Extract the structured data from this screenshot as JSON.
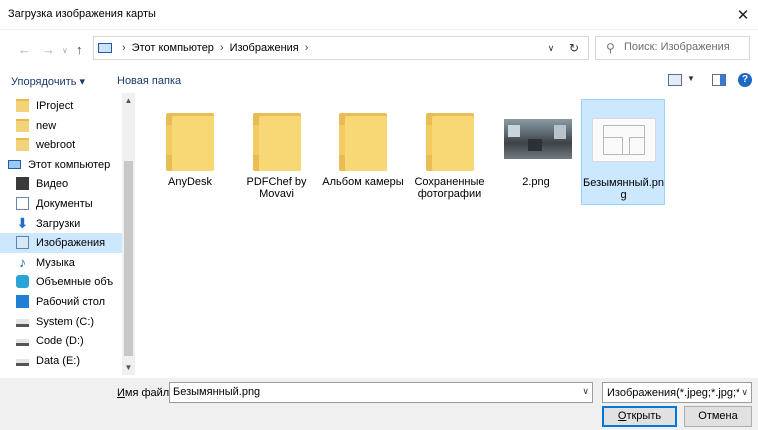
{
  "window": {
    "title": "Загрузка изображения карты",
    "close_glyph": "✕"
  },
  "address": {
    "crumbs": [
      "Этот компьютер",
      "Изображения"
    ],
    "separator": "›",
    "search_placeholder": "Поиск: Изображения"
  },
  "toolbar": {
    "organize_label": "Упорядочить ▾",
    "new_folder_label": "Новая папка"
  },
  "nav": {
    "items": [
      {
        "label": "IProject",
        "icon": "folder-icon",
        "indent": 1
      },
      {
        "label": "new",
        "icon": "folder-icon",
        "indent": 1
      },
      {
        "label": "webroot",
        "icon": "folder-icon",
        "indent": 1
      },
      {
        "label": "Этот компьютер",
        "icon": "computer-icon",
        "indent": 0
      },
      {
        "label": "Видео",
        "icon": "video-icon",
        "indent": 1
      },
      {
        "label": "Документы",
        "icon": "documents-icon",
        "indent": 1
      },
      {
        "label": "Загрузки",
        "icon": "downloads-icon",
        "indent": 1
      },
      {
        "label": "Изображения",
        "icon": "pictures-icon",
        "indent": 1,
        "selected": true
      },
      {
        "label": "Музыка",
        "icon": "music-icon",
        "indent": 1
      },
      {
        "label": "Объемные объ",
        "icon": "3d-objects-icon",
        "indent": 1
      },
      {
        "label": "Рабочий стол",
        "icon": "desktop-icon",
        "indent": 1
      },
      {
        "label": "System (C:)",
        "icon": "system-drive-icon",
        "indent": 1
      },
      {
        "label": "Code (D:)",
        "icon": "drive-icon",
        "indent": 1
      },
      {
        "label": "Data (E:)",
        "icon": "drive-icon",
        "indent": 1
      }
    ]
  },
  "files": [
    {
      "label": "AnyDesk",
      "type": "folder",
      "thumb": "document-preview"
    },
    {
      "label": "PDFChef by Movavi",
      "type": "folder"
    },
    {
      "label": "Альбом камеры",
      "type": "folder"
    },
    {
      "label": "Сохраненные фотографии",
      "type": "folder"
    },
    {
      "label": "2.png",
      "type": "image",
      "thumb": "photo"
    },
    {
      "label": "Безымянный.png",
      "type": "image",
      "thumb": "floorplan",
      "selected": true
    }
  ],
  "bottom": {
    "filename_label_accel": "И",
    "filename_label_rest": "мя файла:",
    "filename_value": "Безымянный.png",
    "filter_value": "Изображения(*.jpeg;*.jpg;*.pn",
    "open_accel": "О",
    "open_rest": "ткрыть",
    "cancel_label": "Отмена"
  }
}
